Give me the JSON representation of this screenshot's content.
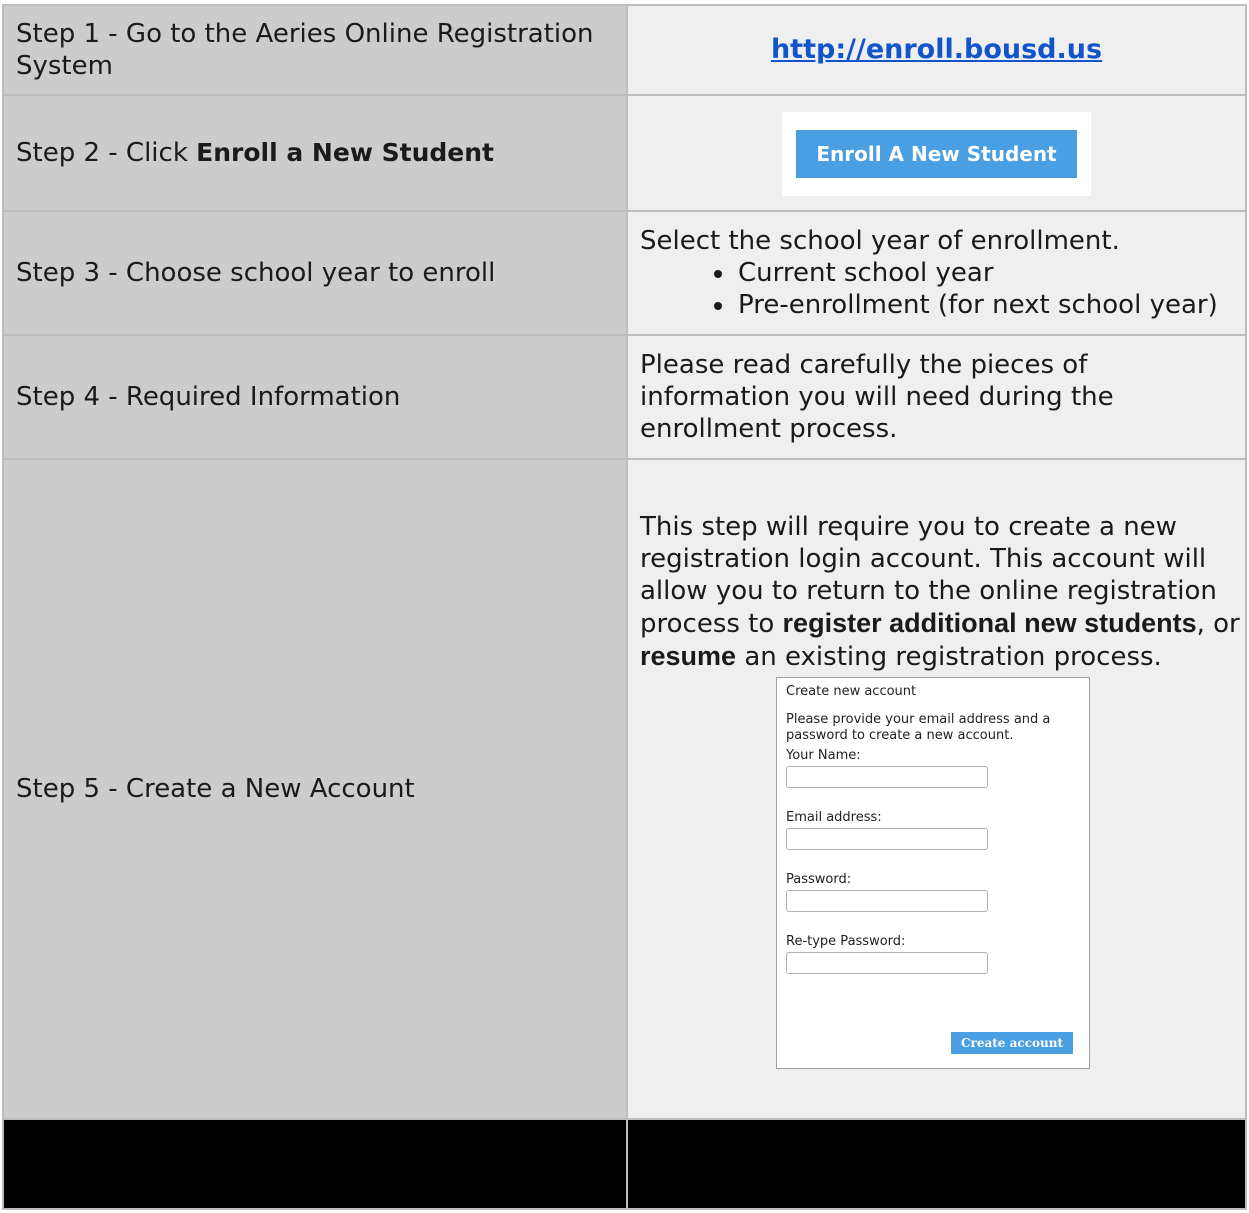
{
  "steps": [
    {
      "label": "Step 1 - Go to the Aeries Online Registration System",
      "link_text": "http://enroll.bousd.us"
    },
    {
      "label_prefix": "Step 2 - Click ",
      "label_bold": "Enroll a New Student",
      "button_label": "Enroll A New Student"
    },
    {
      "label": "Step 3 - Choose school year to enroll",
      "intro": "Select the school year of enrollment.",
      "options": [
        "Current school year",
        "Pre-enrollment (for next school year)"
      ]
    },
    {
      "label": "Step 4 - Required Information",
      "text": "Please read carefully the pieces of information you will need during the enrollment process."
    },
    {
      "label": "Step 5 - Create a New Account",
      "text_1": "This step will require you to create a new registration login account.  This account will allow you to return to the online registration process to ",
      "bold_1": "register additional new students",
      "text_2": ", or ",
      "bold_2": "resume",
      "text_3": " an existing registration process."
    }
  ],
  "account_form": {
    "title": "Create new account",
    "description": "Please provide your email address and a password to create a new account.",
    "fields": [
      {
        "label": "Your Name:",
        "value": ""
      },
      {
        "label": "Email address:",
        "value": ""
      },
      {
        "label": "Password:",
        "value": ""
      },
      {
        "label": "Re-type Password:",
        "value": ""
      }
    ],
    "submit_label": "Create account"
  },
  "colors": {
    "left_cell": "#cccccc",
    "right_cell": "#efefef",
    "button_blue": "#4a9fe3",
    "link_blue": "#1155cc"
  }
}
